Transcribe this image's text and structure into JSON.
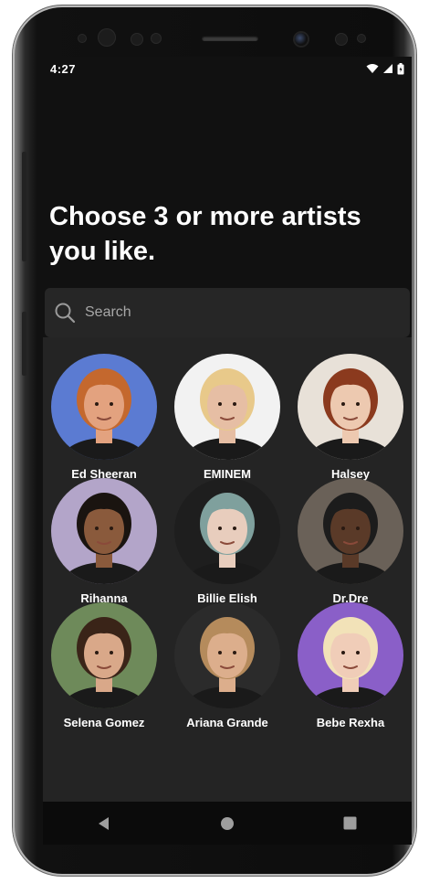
{
  "status_bar": {
    "time": "4:27",
    "icons": [
      "wifi-icon",
      "signal-icon",
      "battery-icon"
    ]
  },
  "onboarding": {
    "title_line1": "Choose 3 or more artists",
    "title_line2": "you like."
  },
  "search": {
    "placeholder": "Search",
    "value": ""
  },
  "artists": [
    {
      "name": "Ed Sheeran",
      "bg": "#5b7bd2",
      "skin": "#e3a27f",
      "hair": "#c4682e"
    },
    {
      "name": "EMINEM",
      "bg": "#f2f2f2",
      "skin": "#e6bea4",
      "hair": "#e8c98a"
    },
    {
      "name": "Halsey",
      "bg": "#e8e1d8",
      "skin": "#edc9b0",
      "hair": "#8b3a1e"
    },
    {
      "name": "Rihanna",
      "bg": "#b3a5c9",
      "skin": "#8a5a3c",
      "hair": "#1a1410"
    },
    {
      "name": "Billie Elish",
      "bg": "#1e1e1e",
      "skin": "#e8cdbd",
      "hair": "#7fa09d"
    },
    {
      "name": "Dr.Dre",
      "bg": "#6a6158",
      "skin": "#5a3a28",
      "hair": "#1c1c1c"
    },
    {
      "name": "Selena Gomez",
      "bg": "#6e8a5a",
      "skin": "#d9a889",
      "hair": "#3a2418"
    },
    {
      "name": "Ariana Grande",
      "bg": "#2b2b2b",
      "skin": "#dcae8c",
      "hair": "#b58b5c"
    },
    {
      "name": "Bebe Rexha",
      "bg": "#8a5fc8",
      "skin": "#f0cdb8",
      "hair": "#f2e2b8"
    }
  ],
  "nav": {
    "buttons": [
      "back-icon",
      "home-icon",
      "recents-icon"
    ]
  }
}
